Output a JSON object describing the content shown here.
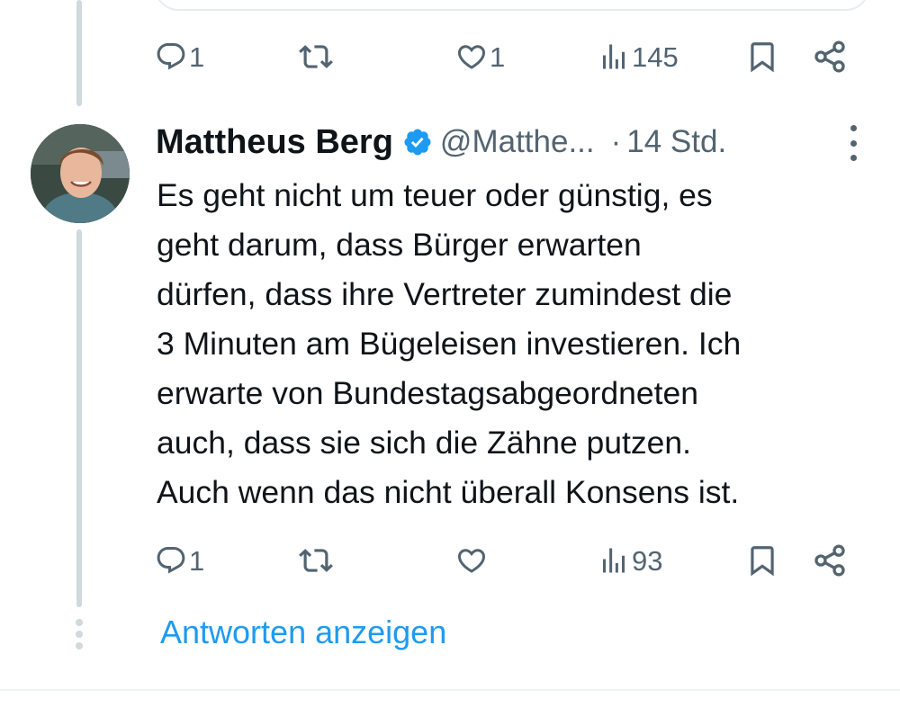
{
  "previous_tweet": {
    "actions": {
      "reply_icon": "reply-icon",
      "reply_count": "1",
      "retweet_icon": "retweet-icon",
      "like_icon": "heart-icon",
      "like_count": "1",
      "views_icon": "views-icon",
      "views_count": "145",
      "bookmark_icon": "bookmark-icon",
      "share_icon": "share-icon"
    }
  },
  "tweet": {
    "author_name": "Mattheus Berg",
    "verified_icon": "verified-badge-icon",
    "handle": "@Matthe...",
    "separator": "·",
    "time": "14 Std.",
    "more_icon": "more-vertical-icon",
    "text_lines": [
      "Es geht nicht um teuer oder günstig, es",
      "geht darum, dass Bürger erwarten",
      "dürfen, dass ihre Vertreter zumindest die",
      "3 Minuten am Bügeleisen investieren. Ich",
      "erwarte von Bundestagsabgeordneten",
      "auch, dass sie sich die Zähne putzen.",
      "Auch wenn das nicht überall Konsens ist."
    ],
    "actions": {
      "reply_count": "1",
      "retweet_count": "",
      "like_count": "",
      "views_count": "93"
    }
  },
  "show_replies_label": "Antworten anzeigen",
  "colors": {
    "accent": "#1d9bf0",
    "text_primary": "#0f1419",
    "text_secondary": "#536471",
    "thread_line": "#cfd9de"
  }
}
